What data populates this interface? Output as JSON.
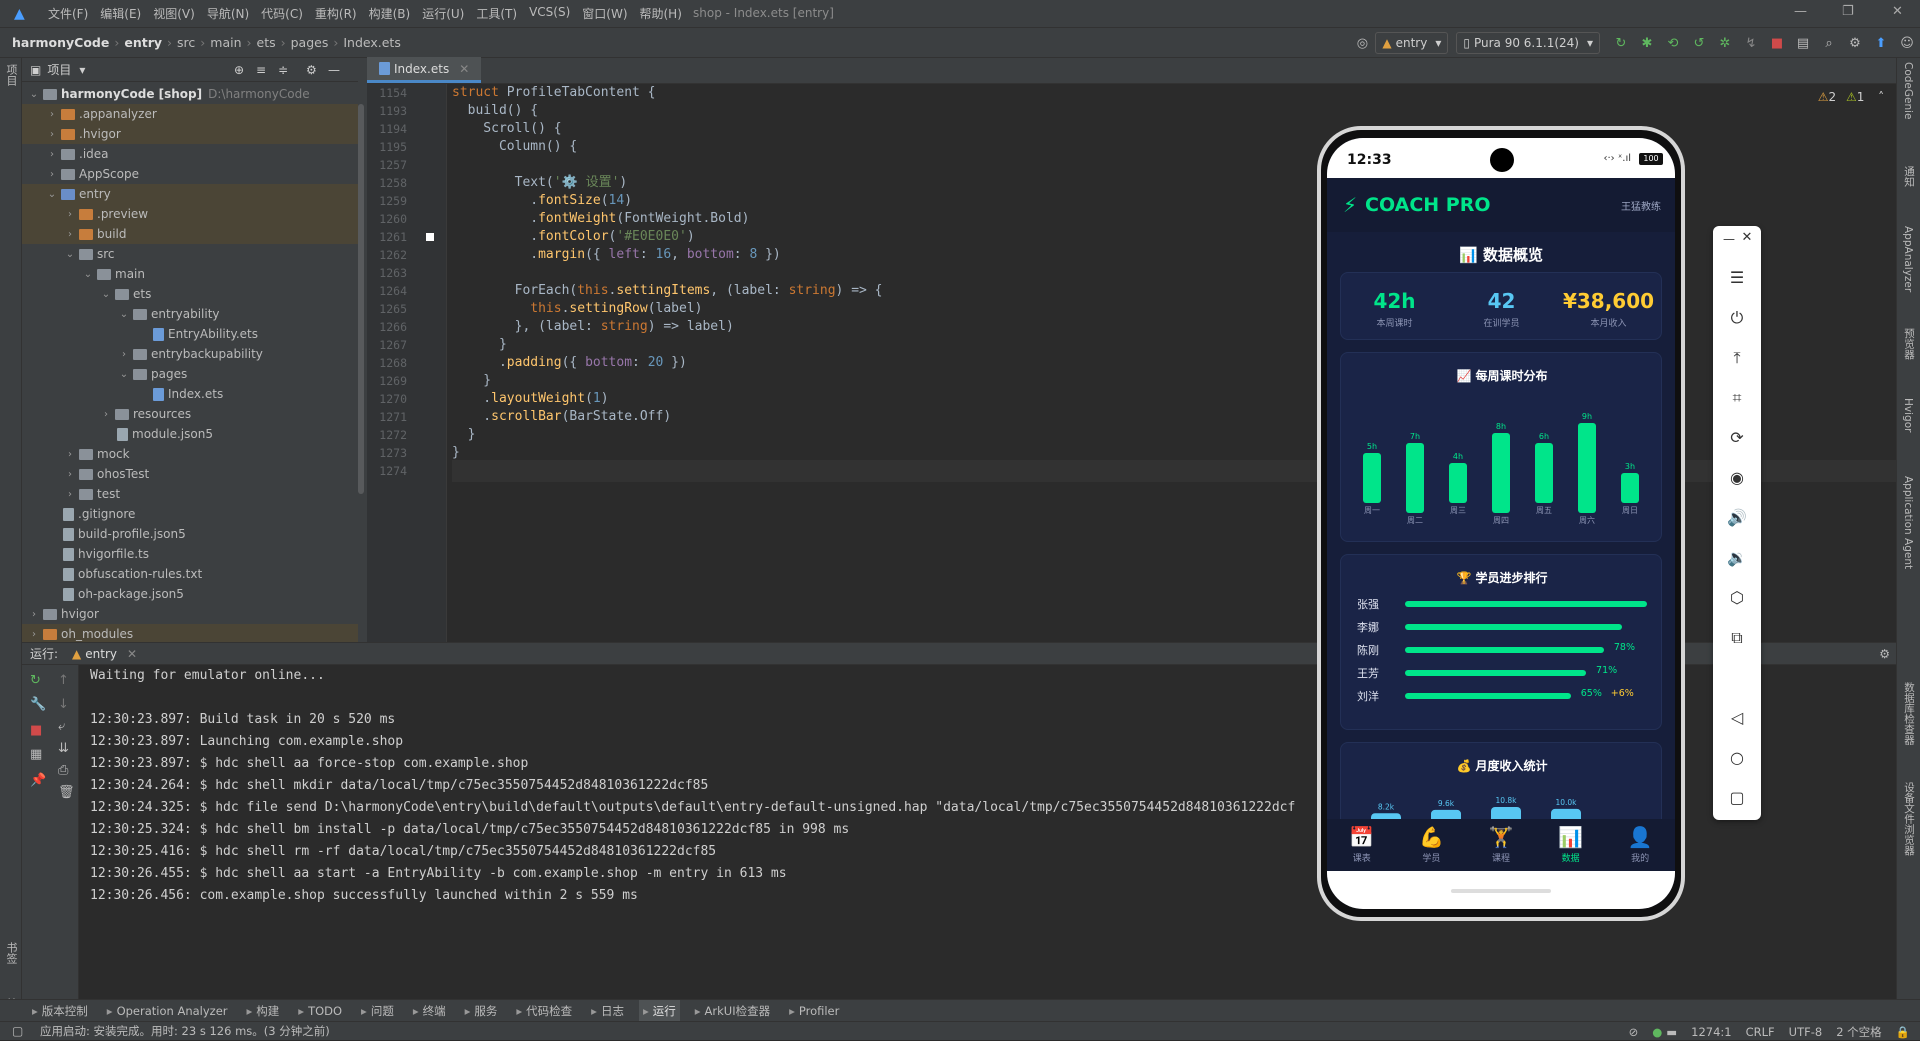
{
  "menu": {
    "items": [
      "文件(F)",
      "编辑(E)",
      "视图(V)",
      "导航(N)",
      "代码(C)",
      "重构(R)",
      "构建(B)",
      "运行(U)",
      "工具(T)",
      "VCS(S)",
      "窗口(W)",
      "帮助(H)"
    ],
    "window_title": "shop - Index.ets [entry]"
  },
  "breadcrumb": [
    "harmonyCode",
    "entry",
    "src",
    "main",
    "ets",
    "pages",
    "Index.ets"
  ],
  "toolbar": {
    "run_config": "entry",
    "device": "Pura 90 6.1.1(24)"
  },
  "project_panel": {
    "title": "项目",
    "root_name": "harmonyCode [shop]",
    "root_path": "D:\\harmonyCode",
    "items": [
      {
        "label": ".appanalyzer",
        "kind": "folder-orange"
      },
      {
        "label": ".hvigor",
        "kind": "folder-orange"
      },
      {
        "label": ".idea",
        "kind": "folder-gray"
      },
      {
        "label": "AppScope",
        "kind": "folder-gray"
      },
      {
        "label": "entry",
        "kind": "folder-blue"
      },
      {
        "label": ".preview",
        "kind": "folder-orange"
      },
      {
        "label": "build",
        "kind": "folder-orange"
      },
      {
        "label": "src",
        "kind": "folder-gray"
      },
      {
        "label": "main",
        "kind": "folder-gray"
      },
      {
        "label": "ets",
        "kind": "folder-gray"
      },
      {
        "label": "entryability",
        "kind": "folder-gray"
      },
      {
        "label": "EntryAbility.ets",
        "kind": "file-ets"
      },
      {
        "label": "entrybackupability",
        "kind": "folder-gray"
      },
      {
        "label": "pages",
        "kind": "folder-gray"
      },
      {
        "label": "Index.ets",
        "kind": "file-ets"
      },
      {
        "label": "resources",
        "kind": "folder-gray"
      },
      {
        "label": "module.json5",
        "kind": "file"
      },
      {
        "label": "mock",
        "kind": "folder-gray"
      },
      {
        "label": "ohosTest",
        "kind": "folder-gray"
      },
      {
        "label": "test",
        "kind": "folder-gray"
      },
      {
        "label": ".gitignore",
        "kind": "file"
      },
      {
        "label": "build-profile.json5",
        "kind": "file"
      },
      {
        "label": "hvigorfile.ts",
        "kind": "file"
      },
      {
        "label": "obfuscation-rules.txt",
        "kind": "file"
      },
      {
        "label": "oh-package.json5",
        "kind": "file"
      },
      {
        "label": "hvigor",
        "kind": "folder-gray"
      },
      {
        "label": "oh_modules",
        "kind": "folder-orange"
      }
    ]
  },
  "editor": {
    "tab": "Index.ets",
    "inspections": {
      "warnings": "2",
      "weak": "1"
    },
    "line_numbers": [
      "1154",
      "1193",
      "1194",
      "1195",
      "1257",
      "1258",
      "1259",
      "1260",
      "1261",
      "1262",
      "1263",
      "1264",
      "1265",
      "1266",
      "1267",
      "1268",
      "1269",
      "1270",
      "1271",
      "1272",
      "1273",
      "1274"
    ],
    "lines": [
      "struct ProfileTabContent {",
      "  build() {",
      "    Scroll() {",
      "      Column() {",
      "",
      "        Text('⚙️ 设置')",
      "          .fontSize(14)",
      "          .fontWeight(FontWeight.Bold)",
      "          .fontColor('#E0E0E0')",
      "          .margin({ left: 16, bottom: 8 })",
      "",
      "        ForEach(this.settingItems, (label: string) => {",
      "          this.settingRow(label)",
      "        }, (label: string) => label)",
      "      }",
      "      .padding({ bottom: 20 })",
      "    }",
      "    .layoutWeight(1)",
      "    .scrollBar(BarState.Off)",
      "  }",
      "}",
      ""
    ]
  },
  "run_panel": {
    "label": "运行:",
    "tab": "entry",
    "console": [
      "Waiting for emulator online...",
      "",
      "12:30:23.897: Build task in 20 s 520 ms",
      "12:30:23.897: Launching com.example.shop",
      "12:30:23.897: $ hdc shell aa force-stop com.example.shop",
      "12:30:24.264: $ hdc shell mkdir data/local/tmp/c75ec3550754452d84810361222dcf85",
      "12:30:24.325: $ hdc file send D:\\harmonyCode\\entry\\build\\default\\outputs\\default\\entry-default-unsigned.hap \"data/local/tmp/c75ec3550754452d84810361222dcf",
      "12:30:25.324: $ hdc shell bm install -p data/local/tmp/c75ec3550754452d84810361222dcf85 in 998 ms",
      "12:30:25.416: $ hdc shell rm -rf data/local/tmp/c75ec3550754452d84810361222dcf85",
      "12:30:26.455: $ hdc shell aa start -a EntryAbility -b com.example.shop -m entry in 613 ms",
      "12:30:26.456: com.example.shop successfully launched within 2 s 559 ms"
    ]
  },
  "left_strip": {
    "top": "项目",
    "bottom1": "书签",
    "bottom2": "结构"
  },
  "right_strip": [
    "CodeGenie",
    "通知",
    "AppAnalyzer",
    "预览器",
    "Hvigor",
    "Application Agent",
    "数据库检查器",
    "设备文件浏览器"
  ],
  "bottom_tabs": [
    "版本控制",
    "Operation Analyzer",
    "构建",
    "TODO",
    "问题",
    "终端",
    "服务",
    "代码检查",
    "日志",
    "运行",
    "ArkUI检查器",
    "Profiler"
  ],
  "status": {
    "message": "应用启动: 安装完成。用时: 23 s 126 ms。(3 分钟之前)",
    "position": "1274:1",
    "line_sep": "CRLF",
    "encoding": "UTF-8",
    "indent": "2 个空格"
  },
  "phone": {
    "time": "12:33",
    "battery": "100",
    "brand": "COACH PRO",
    "coach": "王猛教练",
    "overview_title": "📊 数据概览",
    "kpis": [
      {
        "value": "42h",
        "label": "本周课时",
        "color": "#00e58a"
      },
      {
        "value": "42",
        "label": "在训学员",
        "color": "#58c7f3"
      },
      {
        "value": "¥38,600",
        "label": "本月收入",
        "color": "#ffcc33"
      }
    ],
    "weekly_title": "📈 每周课时分布",
    "chart_data": {
      "type": "bar",
      "categories": [
        "周一",
        "周二",
        "周三",
        "周四",
        "周五",
        "周六",
        "周日"
      ],
      "values": [
        5,
        7,
        4,
        8,
        6,
        9,
        3
      ],
      "value_labels": [
        "5h",
        "7h",
        "4h",
        "8h",
        "6h",
        "9h",
        "3h"
      ]
    },
    "ranking_title": "🏆 学员进步排行",
    "ranking": [
      {
        "name": "张强",
        "pct": 95,
        "label": ""
      },
      {
        "name": "李娜",
        "pct": 85,
        "label": ""
      },
      {
        "name": "陈刚",
        "pct": 78,
        "label": "78%"
      },
      {
        "name": "王芳",
        "pct": 71,
        "label": "71%"
      },
      {
        "name": "刘洋",
        "pct": 65,
        "label": "65%",
        "extra": "+6%"
      }
    ],
    "income_title": "💰 月度收入统计",
    "income_chart": {
      "type": "bar",
      "values": [
        8.2,
        9.6,
        10.8,
        10.0
      ],
      "value_labels": [
        "8.2k",
        "9.6k",
        "10.8k",
        "10.0k"
      ]
    },
    "nav": [
      {
        "icon": "📅",
        "label": "课表"
      },
      {
        "icon": "💪",
        "label": "学员"
      },
      {
        "icon": "🏋",
        "label": "课程"
      },
      {
        "icon": "📊",
        "label": "数据",
        "active": true
      },
      {
        "icon": "👤",
        "label": "我的"
      }
    ]
  },
  "colors": {
    "accent": "#00e58a",
    "blue": "#58c7f3",
    "gold": "#ffcc33",
    "ide_bg": "#2b2b2b"
  }
}
